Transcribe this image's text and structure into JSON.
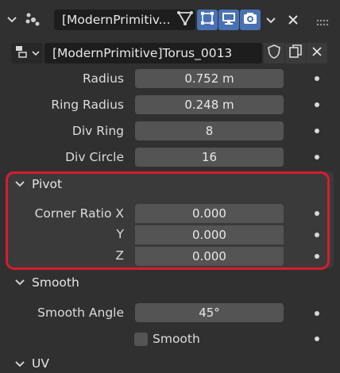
{
  "header": {
    "object_name": "[ModernPrimitiv...",
    "buttons": [
      "filter-icon",
      "select-icon",
      "monitor-icon",
      "camera-icon",
      "chevron-down-icon",
      "close-icon"
    ]
  },
  "datablock": {
    "name": "[ModernPrimitive]Torus_0013"
  },
  "main_props": [
    {
      "label": "Radius",
      "value": "0.752 m"
    },
    {
      "label": "Ring Radius",
      "value": "0.248 m"
    },
    {
      "label": "Div Ring",
      "value": "8"
    },
    {
      "label": "Div Circle",
      "value": "16"
    }
  ],
  "pivot_panel": {
    "title": "Pivot",
    "corner_ratio_label": "Corner Ratio X",
    "y_label": "Y",
    "z_label": "Z",
    "x_value": "0.000",
    "y_value": "0.000",
    "z_value": "0.000"
  },
  "smooth_panel": {
    "title": "Smooth",
    "angle_label": "Smooth Angle",
    "angle_value": "45°",
    "smooth_checkbox_label": "Smooth",
    "smooth_checked": false
  },
  "uv_panel": {
    "title": "UV"
  },
  "colors": {
    "background": "#303030",
    "panel": "#3a3a3a",
    "field": "#545454",
    "active_button": "#4872b4",
    "highlight": "#d81c2e"
  }
}
